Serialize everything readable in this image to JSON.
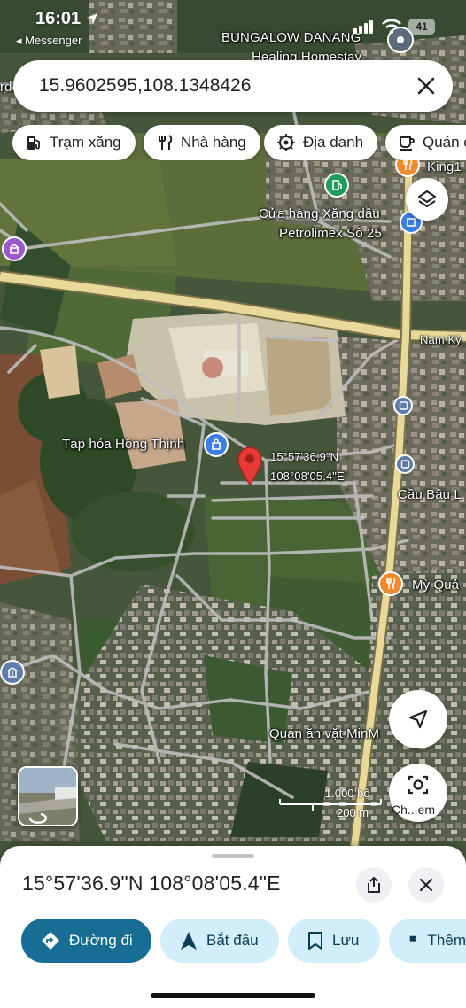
{
  "status_bar": {
    "time": "16:01",
    "back_app": "Messenger",
    "battery": "41"
  },
  "search": {
    "query": "15.9602595,108.1348426"
  },
  "chips": [
    {
      "label": "Trạm xăng",
      "icon": "gas-station-icon"
    },
    {
      "label": "Nhà hàng",
      "icon": "restaurant-icon"
    },
    {
      "label": "Địa danh",
      "icon": "landmark-icon"
    },
    {
      "label": "Quán cà",
      "icon": "coffee-icon"
    }
  ],
  "map": {
    "labels": {
      "bungalow_line1": "BUNGALOW DANANG",
      "bungalow_line2": "Healing Homestay",
      "king": "King1",
      "petrolimex_line1": "Cửa hàng Xăng dầu",
      "petrolimex_line2": "Petrolimex Số 25",
      "nam_ky": "Nam Kỳ",
      "tap_hoa": "Tạp hóa Hồng Thịnh",
      "pin_lat": "15°57'36.9\"N",
      "pin_lng": "108°08'05.4\"E",
      "cau_bau": "Cầu Bầu L",
      "my_quang": "Mỳ Quả",
      "quan_an": "Quán ăn vặt MinM",
      "left_edge": "rde"
    },
    "scale": {
      "feet": "1.000 bộ",
      "meters": "200 m"
    },
    "colors": {
      "road_major": "#e8d99a",
      "road_minor": "#bfbfbf",
      "pin": "#e53935",
      "poi_orange": "#f08a2a",
      "poi_blue": "#3d7ee6",
      "poi_green": "#1e9e5a",
      "poi_purple": "#9b59d0"
    }
  },
  "explore_label": "Ch...em",
  "sheet": {
    "title": "15°57'36.9\"N 108°08'05.4\"E",
    "actions": [
      {
        "label": "Đường đi",
        "icon": "directions-icon"
      },
      {
        "label": "Bắt đầu",
        "icon": "navigation-arrow-icon"
      },
      {
        "label": "Lưu",
        "icon": "bookmark-icon"
      },
      {
        "label": "Thêm",
        "icon": "flag-icon"
      }
    ]
  },
  "accent": "#176d93"
}
